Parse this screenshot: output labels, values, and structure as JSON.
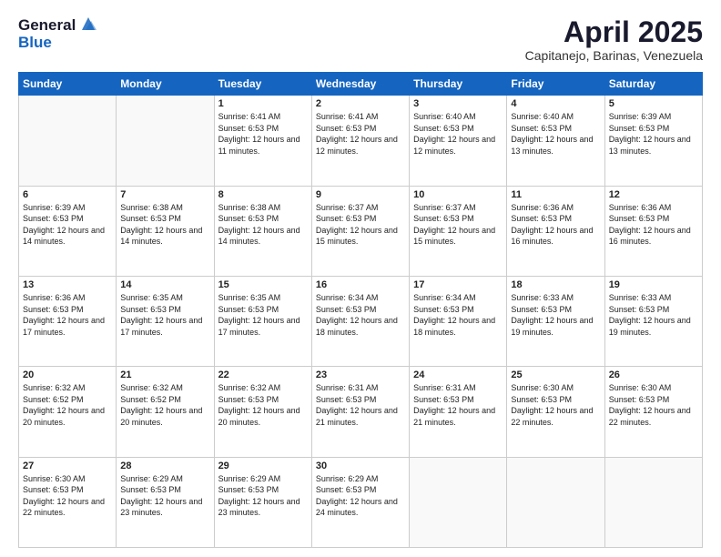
{
  "logo": {
    "general": "General",
    "blue": "Blue"
  },
  "title": {
    "month": "April 2025",
    "location": "Capitanejo, Barinas, Venezuela"
  },
  "days_of_week": [
    "Sunday",
    "Monday",
    "Tuesday",
    "Wednesday",
    "Thursday",
    "Friday",
    "Saturday"
  ],
  "weeks": [
    [
      {
        "day": "",
        "info": ""
      },
      {
        "day": "",
        "info": ""
      },
      {
        "day": "1",
        "info": "Sunrise: 6:41 AM\nSunset: 6:53 PM\nDaylight: 12 hours and 11 minutes."
      },
      {
        "day": "2",
        "info": "Sunrise: 6:41 AM\nSunset: 6:53 PM\nDaylight: 12 hours and 12 minutes."
      },
      {
        "day": "3",
        "info": "Sunrise: 6:40 AM\nSunset: 6:53 PM\nDaylight: 12 hours and 12 minutes."
      },
      {
        "day": "4",
        "info": "Sunrise: 6:40 AM\nSunset: 6:53 PM\nDaylight: 12 hours and 13 minutes."
      },
      {
        "day": "5",
        "info": "Sunrise: 6:39 AM\nSunset: 6:53 PM\nDaylight: 12 hours and 13 minutes."
      }
    ],
    [
      {
        "day": "6",
        "info": "Sunrise: 6:39 AM\nSunset: 6:53 PM\nDaylight: 12 hours and 14 minutes."
      },
      {
        "day": "7",
        "info": "Sunrise: 6:38 AM\nSunset: 6:53 PM\nDaylight: 12 hours and 14 minutes."
      },
      {
        "day": "8",
        "info": "Sunrise: 6:38 AM\nSunset: 6:53 PM\nDaylight: 12 hours and 14 minutes."
      },
      {
        "day": "9",
        "info": "Sunrise: 6:37 AM\nSunset: 6:53 PM\nDaylight: 12 hours and 15 minutes."
      },
      {
        "day": "10",
        "info": "Sunrise: 6:37 AM\nSunset: 6:53 PM\nDaylight: 12 hours and 15 minutes."
      },
      {
        "day": "11",
        "info": "Sunrise: 6:36 AM\nSunset: 6:53 PM\nDaylight: 12 hours and 16 minutes."
      },
      {
        "day": "12",
        "info": "Sunrise: 6:36 AM\nSunset: 6:53 PM\nDaylight: 12 hours and 16 minutes."
      }
    ],
    [
      {
        "day": "13",
        "info": "Sunrise: 6:36 AM\nSunset: 6:53 PM\nDaylight: 12 hours and 17 minutes."
      },
      {
        "day": "14",
        "info": "Sunrise: 6:35 AM\nSunset: 6:53 PM\nDaylight: 12 hours and 17 minutes."
      },
      {
        "day": "15",
        "info": "Sunrise: 6:35 AM\nSunset: 6:53 PM\nDaylight: 12 hours and 17 minutes."
      },
      {
        "day": "16",
        "info": "Sunrise: 6:34 AM\nSunset: 6:53 PM\nDaylight: 12 hours and 18 minutes."
      },
      {
        "day": "17",
        "info": "Sunrise: 6:34 AM\nSunset: 6:53 PM\nDaylight: 12 hours and 18 minutes."
      },
      {
        "day": "18",
        "info": "Sunrise: 6:33 AM\nSunset: 6:53 PM\nDaylight: 12 hours and 19 minutes."
      },
      {
        "day": "19",
        "info": "Sunrise: 6:33 AM\nSunset: 6:53 PM\nDaylight: 12 hours and 19 minutes."
      }
    ],
    [
      {
        "day": "20",
        "info": "Sunrise: 6:32 AM\nSunset: 6:52 PM\nDaylight: 12 hours and 20 minutes."
      },
      {
        "day": "21",
        "info": "Sunrise: 6:32 AM\nSunset: 6:52 PM\nDaylight: 12 hours and 20 minutes."
      },
      {
        "day": "22",
        "info": "Sunrise: 6:32 AM\nSunset: 6:53 PM\nDaylight: 12 hours and 20 minutes."
      },
      {
        "day": "23",
        "info": "Sunrise: 6:31 AM\nSunset: 6:53 PM\nDaylight: 12 hours and 21 minutes."
      },
      {
        "day": "24",
        "info": "Sunrise: 6:31 AM\nSunset: 6:53 PM\nDaylight: 12 hours and 21 minutes."
      },
      {
        "day": "25",
        "info": "Sunrise: 6:30 AM\nSunset: 6:53 PM\nDaylight: 12 hours and 22 minutes."
      },
      {
        "day": "26",
        "info": "Sunrise: 6:30 AM\nSunset: 6:53 PM\nDaylight: 12 hours and 22 minutes."
      }
    ],
    [
      {
        "day": "27",
        "info": "Sunrise: 6:30 AM\nSunset: 6:53 PM\nDaylight: 12 hours and 22 minutes."
      },
      {
        "day": "28",
        "info": "Sunrise: 6:29 AM\nSunset: 6:53 PM\nDaylight: 12 hours and 23 minutes."
      },
      {
        "day": "29",
        "info": "Sunrise: 6:29 AM\nSunset: 6:53 PM\nDaylight: 12 hours and 23 minutes."
      },
      {
        "day": "30",
        "info": "Sunrise: 6:29 AM\nSunset: 6:53 PM\nDaylight: 12 hours and 24 minutes."
      },
      {
        "day": "",
        "info": ""
      },
      {
        "day": "",
        "info": ""
      },
      {
        "day": "",
        "info": ""
      }
    ]
  ]
}
